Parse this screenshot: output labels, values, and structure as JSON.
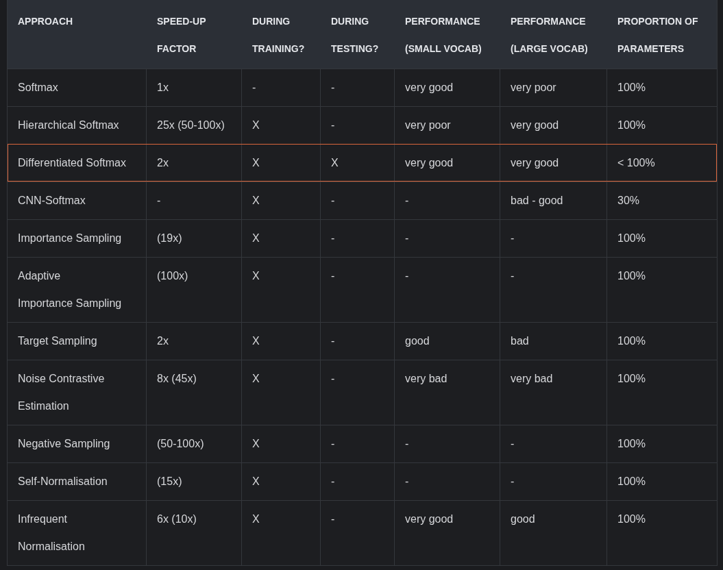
{
  "table": {
    "columns": [
      "APPROACH",
      "SPEED-UP\nFACTOR",
      "DURING\nTRAINING?",
      "DURING\nTESTING?",
      "PERFORMANCE\n(SMALL VOCAB)",
      "PERFORMANCE\n(LARGE VOCAB)",
      "PROPORTION OF\nPARAMETERS"
    ],
    "rows": [
      {
        "highlighted": false,
        "cells": [
          "Softmax",
          "1x",
          "-",
          "-",
          "very good",
          "very poor",
          "100%"
        ]
      },
      {
        "highlighted": false,
        "cells": [
          "Hierarchical Softmax",
          "25x (50-100x)",
          "X",
          "-",
          "very poor",
          "very good",
          "100%"
        ]
      },
      {
        "highlighted": true,
        "cells": [
          "Differentiated Softmax",
          "2x",
          "X",
          "X",
          "very good",
          "very good",
          "< 100%"
        ]
      },
      {
        "highlighted": false,
        "cells": [
          "CNN-Softmax",
          "-",
          "X",
          "-",
          "-",
          "bad - good",
          "30%"
        ]
      },
      {
        "highlighted": false,
        "cells": [
          "Importance Sampling",
          "(19x)",
          "X",
          "-",
          "-",
          "-",
          "100%"
        ]
      },
      {
        "highlighted": false,
        "cells": [
          "Adaptive\nImportance Sampling",
          "(100x)",
          "X",
          "-",
          "-",
          "-",
          "100%"
        ]
      },
      {
        "highlighted": false,
        "cells": [
          "Target Sampling",
          "2x",
          "X",
          "-",
          "good",
          "bad",
          "100%"
        ]
      },
      {
        "highlighted": false,
        "cells": [
          "Noise Contrastive\nEstimation",
          "8x (45x)",
          "X",
          "-",
          "very bad",
          "very bad",
          "100%"
        ]
      },
      {
        "highlighted": false,
        "cells": [
          "Negative Sampling",
          "(50-100x)",
          "X",
          "-",
          "-",
          "-",
          "100%"
        ]
      },
      {
        "highlighted": false,
        "cells": [
          "Self-Normalisation",
          "(15x)",
          "X",
          "-",
          "-",
          "-",
          "100%"
        ]
      },
      {
        "highlighted": false,
        "cells": [
          "Infrequent\nNormalisation",
          "6x (10x)",
          "X",
          "-",
          "very good",
          "good",
          "100%"
        ]
      }
    ]
  }
}
